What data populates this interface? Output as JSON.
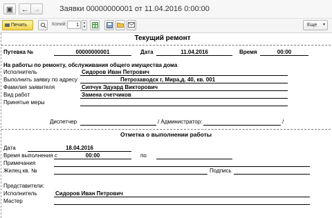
{
  "window": {
    "title": "Заявки 00000000001 от 11.04.2016 0:00:00"
  },
  "nav": {
    "home_glyph": "▣",
    "back_glyph": "←",
    "forward_glyph": "→"
  },
  "toolbar": {
    "print_label": "Печать",
    "copies_label": "Копий:",
    "copies_value": "1",
    "more_label": "Еще",
    "icons": [
      "printer-icon",
      "preview-icon",
      "spreadsheet-icon",
      "save-icon",
      "folder-icon",
      "mail-icon"
    ]
  },
  "doc": {
    "title": "Текущий ремонт",
    "header": {
      "putevka_label": "Путевка №",
      "putevka_value": "00000000001",
      "date_label": "Дата",
      "date_value": "11.04.2016",
      "time_label": "Время",
      "time_value": "00:00"
    },
    "section_title": "На работы по ремонту, обслуживания общего имущества дома",
    "fields": {
      "executor_label": "Исполнитель",
      "executor_value": "Сидоров Иван Петрович",
      "address_label": "Выполнить заявку по адресу",
      "address_value": "Петрозаводск г, Мира,д. 40, кв. 001",
      "applicant_label": "Фамилия заявителя",
      "applicant_value": "Сипчук Эдуард Викторович",
      "worktype_label": "Вид работ",
      "worktype_value": "Замена счетчиков",
      "measures_label": "Принятые меры"
    },
    "signatures": {
      "dispatcher_label": "Диспетчер",
      "admin_label": "/ Администратор:",
      "slash": "/"
    },
    "completion": {
      "title": "Отметка о выполнении работы",
      "date_label": "Дата",
      "date_value": "18.04.2016",
      "time_from_label": "Время выполнения с",
      "time_from_value": "00:00",
      "to_label": "по",
      "notes_label": "Примечания",
      "resident_label": "Жилец кв. №",
      "signature_label": "Подпись",
      "representatives_label": "Представители:",
      "executor_label": "Исполнитель",
      "executor_value": "Сидоров Иван Петрович",
      "master_label": "Мастер"
    }
  }
}
